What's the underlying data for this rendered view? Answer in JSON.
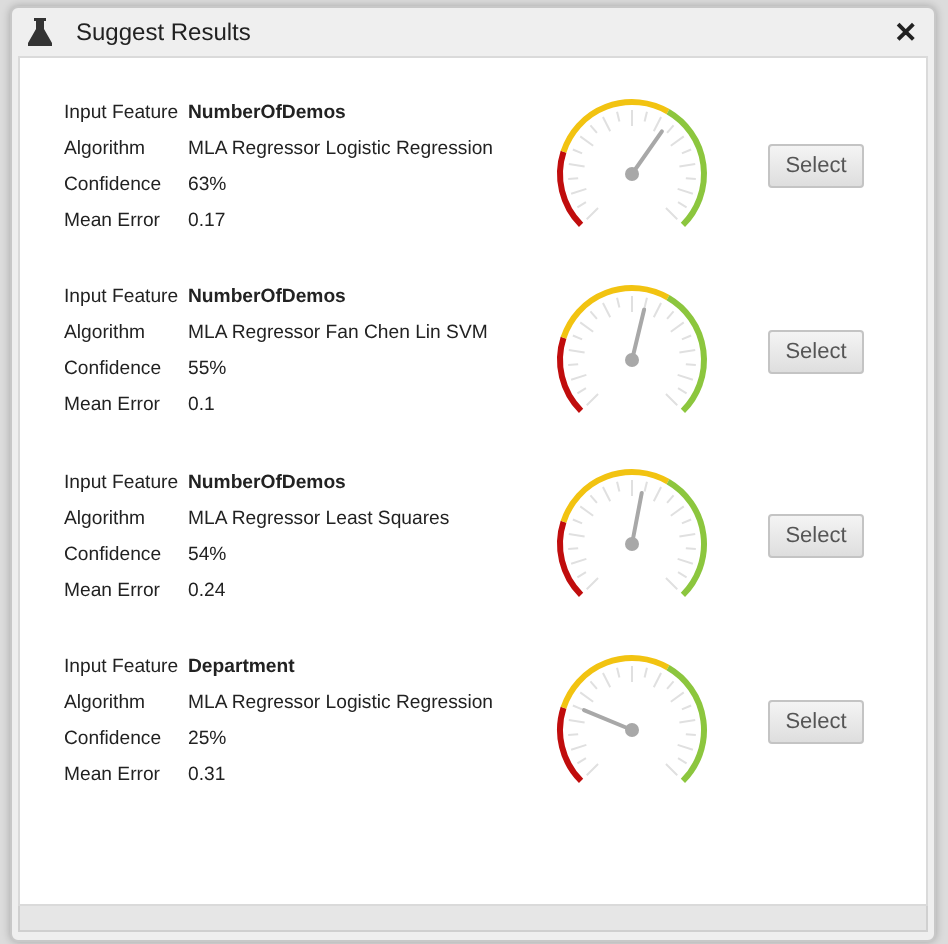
{
  "dialog": {
    "title": "Suggest Results",
    "close": "✕"
  },
  "results": [
    {
      "fields": [
        {
          "label": "Input Feature",
          "value": "NumberOfDemos",
          "bold": true
        },
        {
          "label": "Algorithm",
          "value": "MLA Regressor Logistic Regression",
          "bold": false
        },
        {
          "label": "Confidence",
          "value": "63%",
          "bold": false
        },
        {
          "label": "Mean Error",
          "value": "0.17",
          "bold": false
        }
      ],
      "level": 0.63,
      "button": "Select"
    },
    {
      "fields": [
        {
          "label": "Input Feature",
          "value": "NumberOfDemos",
          "bold": true
        },
        {
          "label": "Algorithm",
          "value": "MLA Regressor Fan Chen Lin SVM",
          "bold": false
        },
        {
          "label": "Confidence",
          "value": "55%",
          "bold": false
        },
        {
          "label": "Mean Error",
          "value": "0.1",
          "bold": false
        }
      ],
      "level": 0.55,
      "button": "Select"
    },
    {
      "fields": [
        {
          "label": "Input Feature",
          "value": "NumberOfDemos",
          "bold": true
        },
        {
          "label": "Algorithm",
          "value": "MLA Regressor Least Squares",
          "bold": false
        },
        {
          "label": "Confidence",
          "value": "54%",
          "bold": false
        },
        {
          "label": "Mean Error",
          "value": "0.24",
          "bold": false
        }
      ],
      "level": 0.54,
      "button": "Select"
    },
    {
      "fields": [
        {
          "label": "Input Feature",
          "value": "Department",
          "bold": true
        },
        {
          "label": "Algorithm",
          "value": "MLA Regressor Logistic Regression",
          "bold": false
        },
        {
          "label": "Confidence",
          "value": "25%",
          "bold": false
        },
        {
          "label": "Mean Error",
          "value": "0.31",
          "bold": false
        }
      ],
      "level": 0.25,
      "button": "Select"
    }
  ]
}
